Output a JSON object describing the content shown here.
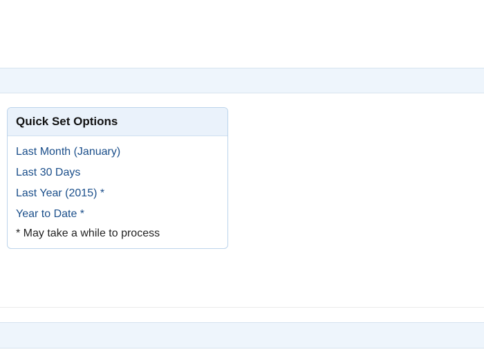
{
  "panel": {
    "title": "Quick Set Options",
    "options": [
      "Last Month (January)",
      "Last 30 Days",
      "Last Year (2015) *",
      "Year to Date *"
    ],
    "footnote": "* May take a while to process"
  }
}
